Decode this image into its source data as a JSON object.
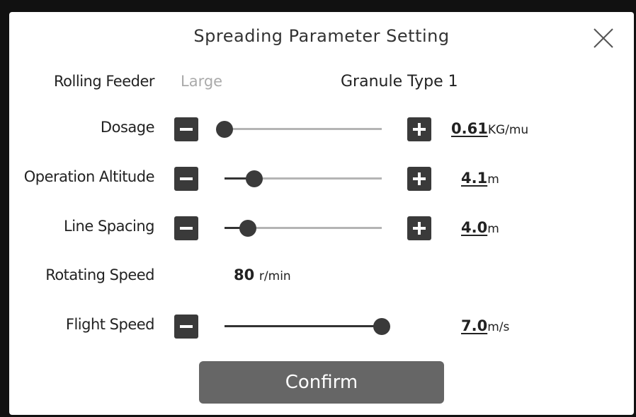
{
  "dialog": {
    "title": "Spreading Parameter Setting",
    "close_icon": "close-icon"
  },
  "rolling_feeder": {
    "label": "Rolling Feeder",
    "size": "Large",
    "granule_type": "Granule Type 1"
  },
  "dosage": {
    "label": "Dosage",
    "value": "0.61",
    "unit": "KG/mu",
    "level": 0.0
  },
  "altitude": {
    "label": "Operation Altitude",
    "value": "4.1",
    "unit": "m",
    "level": 0.19
  },
  "spacing": {
    "label": "Line Spacing",
    "value": "4.0",
    "unit": "m",
    "level": 0.15
  },
  "rotating": {
    "label": "Rotating Speed",
    "value": "80",
    "unit": "r/min"
  },
  "flight": {
    "label": "Flight Speed",
    "value": "7.0",
    "unit": "m/s",
    "level": 1.0
  },
  "confirm_label": "Confirm",
  "colors": {
    "button": "#3a3a3a",
    "track": "#b4b4b4",
    "confirm": "#666666"
  }
}
